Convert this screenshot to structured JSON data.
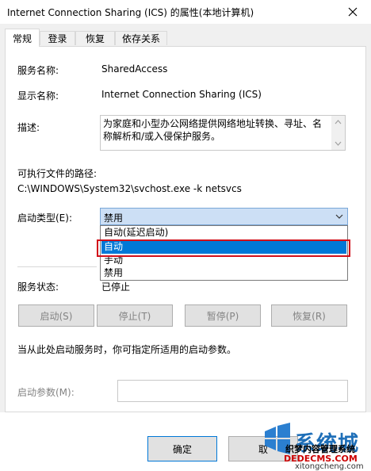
{
  "window": {
    "title": "Internet Connection Sharing (ICS) 的属性(本地计算机)",
    "close_icon": "close-x-icon"
  },
  "tabs": [
    {
      "label": "常规",
      "active": true
    },
    {
      "label": "登录",
      "active": false
    },
    {
      "label": "恢复",
      "active": false
    },
    {
      "label": "依存关系",
      "active": false
    }
  ],
  "general": {
    "service_name_label": "服务名称:",
    "service_name": "SharedAccess",
    "display_name_label": "显示名称:",
    "display_name": "Internet Connection Sharing (ICS)",
    "description_label": "描述:",
    "description": "为家庭和小型办公网络提供网络地址转换、寻址、名称解析和/或入侵保护服务。",
    "exec_path_label": "可执行文件的路径:",
    "exec_path": "C:\\WINDOWS\\System32\\svchost.exe -k netsvcs",
    "startup_type_label": "启动类型(E):",
    "startup_type_value": "禁用",
    "startup_options": [
      {
        "label": "自动(延迟启动)",
        "selected": false
      },
      {
        "label": "自动",
        "selected": true
      },
      {
        "label": "手动",
        "selected": false
      },
      {
        "label": "禁用",
        "selected": false
      }
    ],
    "service_status_label": "服务状态:",
    "service_status": "已停止",
    "buttons": {
      "start": "启动(S)",
      "stop": "停止(T)",
      "pause": "暂停(P)",
      "resume": "恢复(R)"
    },
    "start_hint": "当从此处启动服务时，你可指定所适用的启动参数。",
    "start_params_label": "启动参数(M):",
    "start_params_value": ""
  },
  "footer": {
    "ok": "确定",
    "cancel": "取"
  },
  "watermark": {
    "brand": "系统城",
    "url": "xitongcheng.com",
    "overlay_text": "织梦内容管理系统",
    "overlay_url": "DEDECMS.COM"
  },
  "colors": {
    "selection": "#0078d7",
    "highlight_box": "#d20f1a",
    "combo_bg": "#ccdff5"
  }
}
